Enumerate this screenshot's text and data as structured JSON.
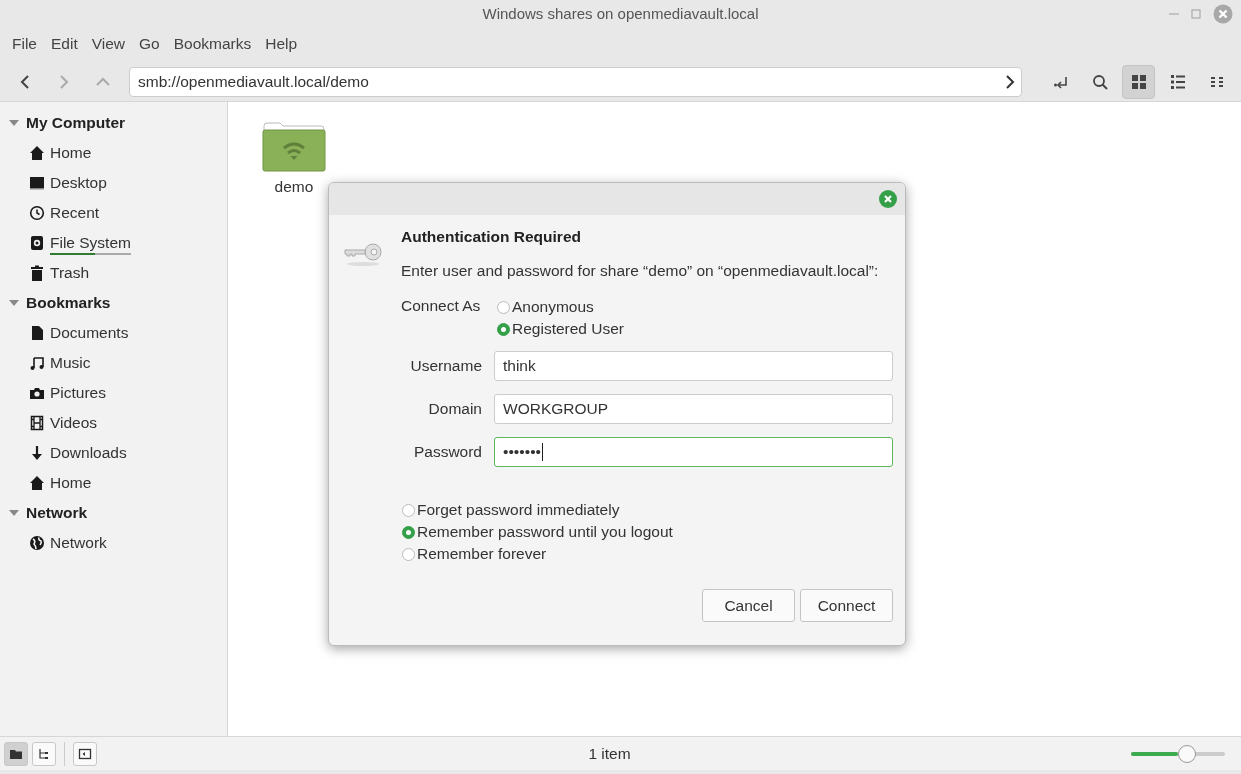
{
  "window": {
    "title": "Windows shares on openmediavault.local"
  },
  "menu": [
    "File",
    "Edit",
    "View",
    "Go",
    "Bookmarks",
    "Help"
  ],
  "toolbar": {
    "location": "smb://openmediavault.local/demo",
    "views": [
      {
        "kind": "icons",
        "selected": true
      },
      {
        "kind": "list",
        "selected": false
      },
      {
        "kind": "compact",
        "selected": false
      }
    ]
  },
  "sidebar": [
    {
      "title": "My Computer",
      "expanded": true,
      "items": [
        {
          "kind": "home",
          "label": "Home"
        },
        {
          "kind": "desktop",
          "label": "Desktop"
        },
        {
          "kind": "recent",
          "label": "Recent"
        },
        {
          "kind": "drive",
          "label": "File System",
          "level": 0.55
        },
        {
          "kind": "trash",
          "label": "Trash"
        }
      ]
    },
    {
      "title": "Bookmarks",
      "expanded": true,
      "items": [
        {
          "kind": "document",
          "label": "Documents"
        },
        {
          "kind": "music",
          "label": "Music"
        },
        {
          "kind": "camera",
          "label": "Pictures"
        },
        {
          "kind": "film",
          "label": "Videos"
        },
        {
          "kind": "download",
          "label": "Downloads"
        },
        {
          "kind": "home",
          "label": "Home"
        }
      ]
    },
    {
      "title": "Network",
      "expanded": true,
      "items": [
        {
          "kind": "globe",
          "label": "Network"
        }
      ]
    }
  ],
  "files": [
    {
      "name": "demo"
    }
  ],
  "dialog": {
    "title": "Authentication Required",
    "message": "Enter user and password for share “demo” on “openmediavault.local”:",
    "connect_as_label": "Connect As",
    "connect_as": [
      {
        "label": "Anonymous",
        "selected": false
      },
      {
        "label": "Registered User",
        "selected": true
      }
    ],
    "fields": [
      {
        "label": "Username",
        "value": "think",
        "focused": false
      },
      {
        "label": "Domain",
        "value": "WORKGROUP",
        "focused": false
      },
      {
        "label": "Password",
        "value": "•••••••",
        "focused": true
      }
    ],
    "remember": [
      {
        "label": "Forget password immediately",
        "selected": false
      },
      {
        "label": "Remember password until you logout",
        "selected": true
      },
      {
        "label": "Remember forever",
        "selected": false
      }
    ],
    "buttons": [
      "Cancel",
      "Connect"
    ]
  },
  "status_bar": {
    "panes": [
      {
        "kind": "places",
        "selected": true
      },
      {
        "kind": "tree",
        "selected": false
      }
    ],
    "text": "1 item",
    "zoom": {
      "level": 0.5
    }
  }
}
